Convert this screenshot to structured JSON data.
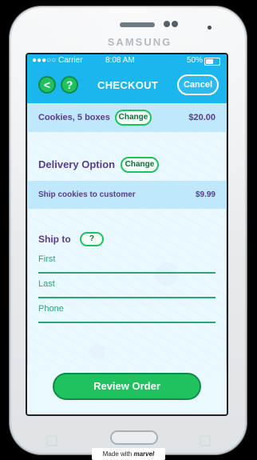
{
  "device": {
    "brand": "SAMSUNG"
  },
  "status_bar": {
    "left": "●●●○○ Carrier",
    "time": "8:08 AM",
    "battery": "50%"
  },
  "nav": {
    "back_label": "<",
    "help_label": "?",
    "title": "CHECKOUT",
    "cancel_label": "Cancel"
  },
  "cart": {
    "label": "Cookies, 5 boxes",
    "change_label": "Change",
    "price": "$20.00"
  },
  "delivery": {
    "title": "Delivery Option",
    "change_label": "Change",
    "option_label": "Ship cookies to customer",
    "option_price": "$9.99"
  },
  "ship_to": {
    "title": "Ship to",
    "help_label": "?",
    "fields": [
      {
        "label": "First"
      },
      {
        "label": "Last"
      },
      {
        "label": "Phone"
      }
    ]
  },
  "primary_action": {
    "label": "Review Order"
  },
  "footer": {
    "badge_prefix": "Made with",
    "badge_brand": "marvel"
  },
  "colors": {
    "accent_blue": "#1cb6ee",
    "accent_green": "#20c260",
    "text_purple": "#5a3d8a",
    "field_green": "#2fa276"
  }
}
